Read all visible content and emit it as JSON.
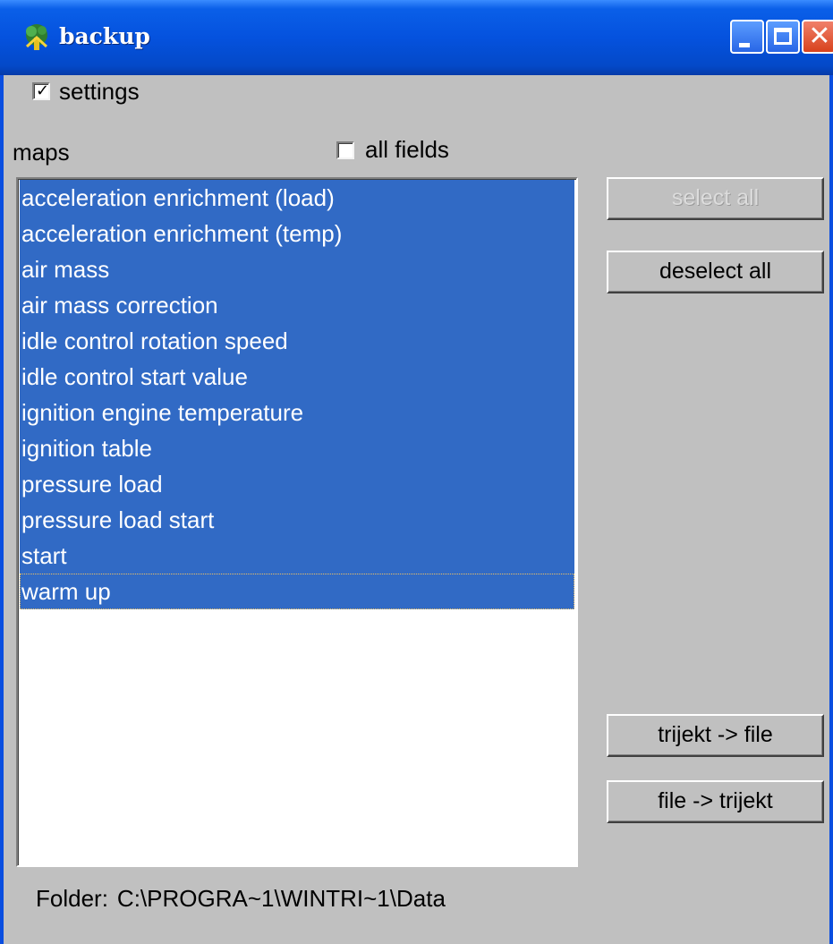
{
  "window": {
    "title": "backup",
    "icon": "tree-app-icon",
    "controls": {
      "minimize": "minimize-icon",
      "maximize": "maximize-icon",
      "close": "close-icon",
      "close_glyph": "✕"
    }
  },
  "settings_checkbox": {
    "label": "settings",
    "checked": true,
    "check_glyph": "✓"
  },
  "maps_label": "maps",
  "all_fields_checkbox": {
    "label": "all fields",
    "checked": false
  },
  "maps_list": {
    "items": [
      {
        "label": "acceleration enrichment (load)",
        "selected": true
      },
      {
        "label": "acceleration enrichment (temp)",
        "selected": true
      },
      {
        "label": "air mass",
        "selected": true
      },
      {
        "label": "air mass correction",
        "selected": true
      },
      {
        "label": "idle control rotation speed",
        "selected": true
      },
      {
        "label": "idle control start value",
        "selected": true
      },
      {
        "label": "ignition engine temperature",
        "selected": true
      },
      {
        "label": "ignition table",
        "selected": true
      },
      {
        "label": "pressure load",
        "selected": true
      },
      {
        "label": "pressure load start",
        "selected": true
      },
      {
        "label": "start",
        "selected": true
      },
      {
        "label": "warm up",
        "selected": true,
        "focused": true
      }
    ]
  },
  "buttons": {
    "select_all": {
      "label": "select all",
      "enabled": false
    },
    "deselect_all": {
      "label": "deselect all",
      "enabled": true
    },
    "trijekt_to_file": {
      "label": "trijekt -> file",
      "enabled": true
    },
    "file_to_trijekt": {
      "label": "file -> trijekt",
      "enabled": true
    }
  },
  "folder": {
    "label": "Folder:",
    "path": "C:\\PROGRA~1\\WINTRI~1\\Data"
  },
  "colors": {
    "selection": "#316ac5",
    "titlebar": "#0552de",
    "dialog_bg": "#c0c0c0"
  }
}
